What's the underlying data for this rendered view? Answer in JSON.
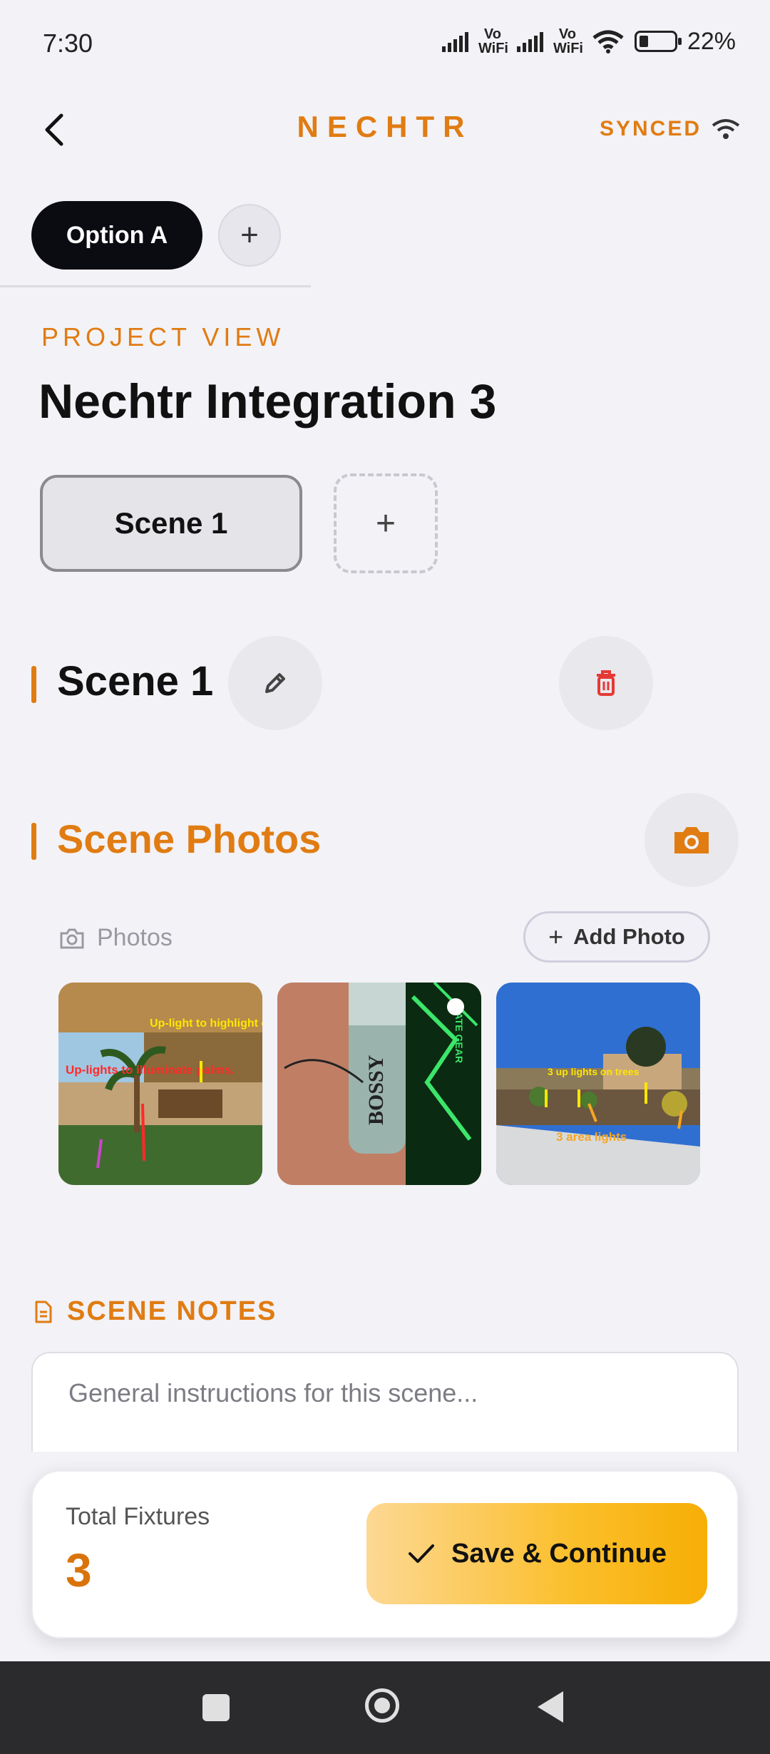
{
  "status_bar": {
    "time": "7:30",
    "vowifi_1": "Vo WiFi",
    "vowifi_2": "Vo WiFi",
    "battery": "22%"
  },
  "header": {
    "brand": "NECHTR",
    "sync_status": "SYNCED",
    "accent_color": "#e07c12"
  },
  "options": {
    "active": "Option A",
    "add_symbol": "+"
  },
  "project": {
    "label": "PROJECT VIEW",
    "title": "Nechtr Integration 3"
  },
  "scenes": {
    "tabs": [
      "Scene 1"
    ],
    "add_symbol": "+"
  },
  "scene": {
    "name": "Scene 1"
  },
  "photos": {
    "heading": "Scene Photos",
    "label": "Photos",
    "add_label": "Add Photo",
    "items": [
      {
        "caption_1": "Up-light to highlight column.",
        "caption_2": "Up-lights to illuminate palms."
      },
      {
        "caption_1": "BOSSY",
        "caption_2": "MATE GEAR"
      },
      {
        "caption_1": "3 up lights on trees",
        "caption_2": "3 area lights"
      }
    ]
  },
  "notes": {
    "label": "SCENE NOTES",
    "placeholder": "General instructions for this scene..."
  },
  "footer": {
    "total_label": "Total Fixtures",
    "total_value": "3",
    "save_label": "Save & Continue"
  }
}
